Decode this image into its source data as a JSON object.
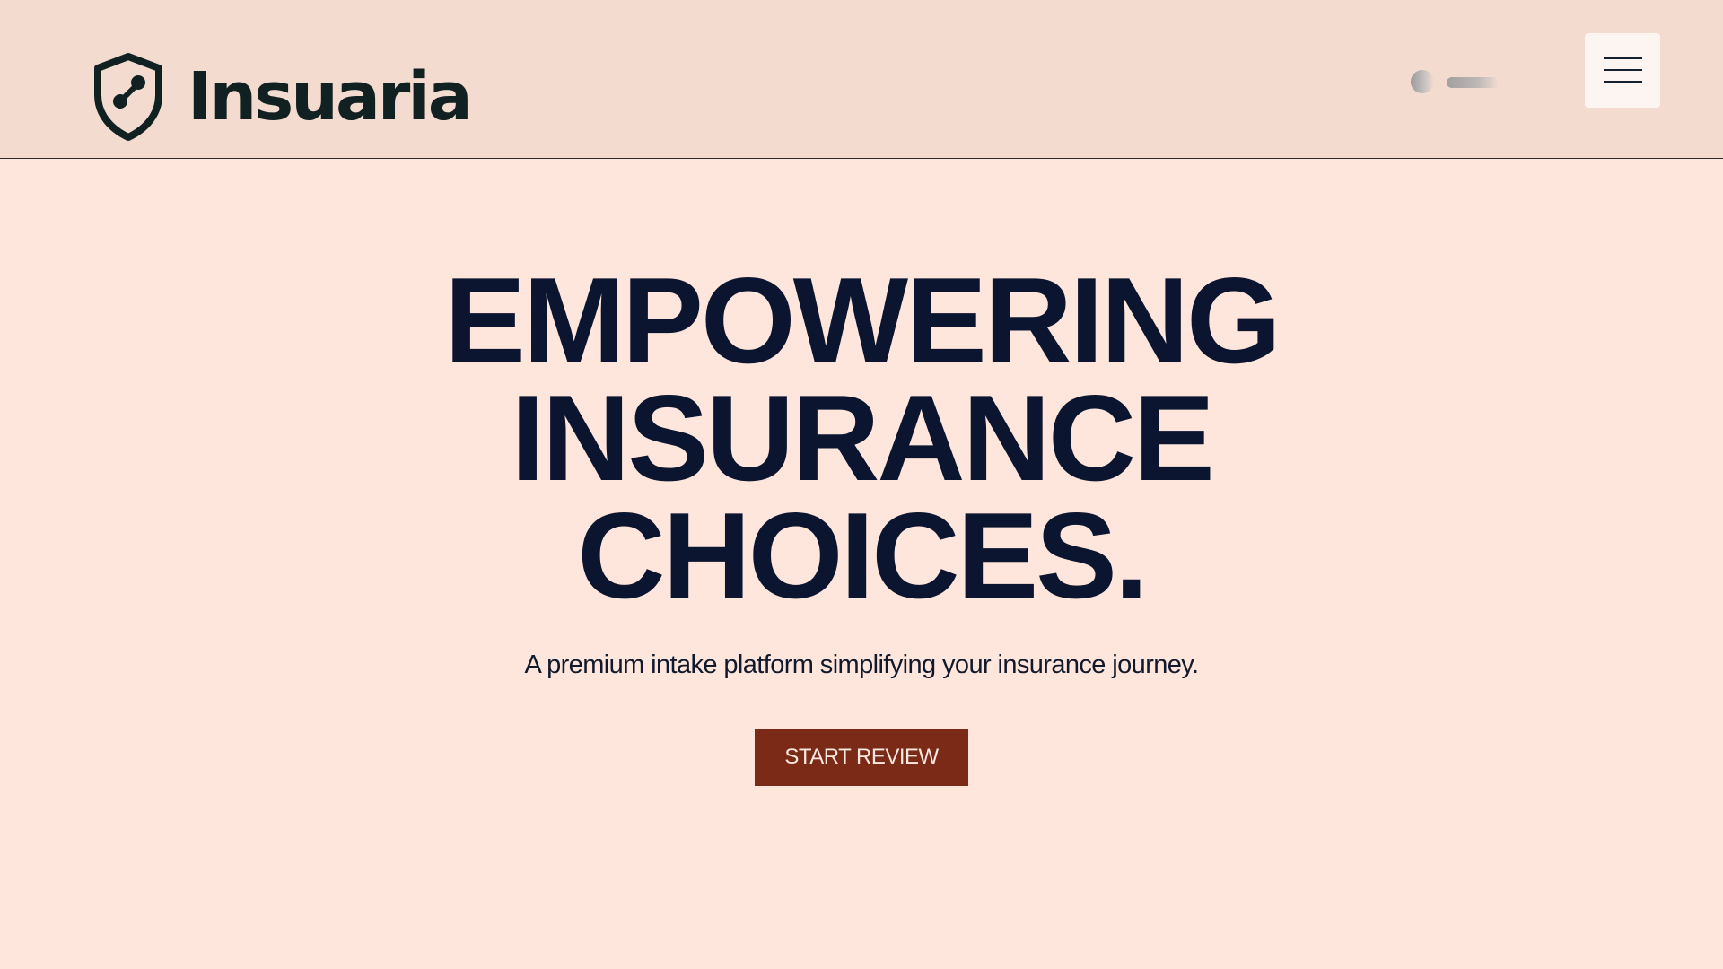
{
  "header": {
    "brand_name": "Insuaria",
    "icons": {
      "logo": "shield-network-icon",
      "loading": "loading-indicator",
      "menu": "hamburger-menu-icon"
    }
  },
  "hero": {
    "headline_lines": [
      "EMPOWERING",
      "INSURANCE",
      "CHOICES."
    ],
    "subtitle": "A premium intake platform simplifying your insurance journey.",
    "cta_label": "START REVIEW"
  },
  "colors": {
    "page_background": "#ffe6dc",
    "header_background": "#f3dbd0",
    "headline": "#0b1530",
    "cta_background": "#7a2a16",
    "cta_text": "#fbe8e0",
    "logo": "#112122"
  }
}
